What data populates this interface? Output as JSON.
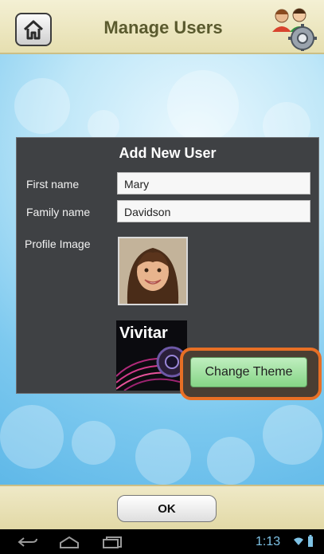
{
  "header": {
    "title": "Manage Users",
    "home_icon": "home-icon",
    "users_icon": "users-settings-icon"
  },
  "dialog": {
    "title": "Add New User",
    "first_name_label": "First name",
    "first_name_value": "Mary",
    "family_name_label": "Family name",
    "family_name_value": "Davidson",
    "profile_image_label": "Profile Image",
    "theme_thumbnail_text": "Vivitar",
    "change_theme_label": "Change Theme"
  },
  "footer": {
    "ok_label": "OK"
  },
  "system_bar": {
    "time": "1:13",
    "back_icon": "back-icon",
    "home_icon": "nav-home-icon",
    "recent_icon": "recent-apps-icon"
  },
  "colors": {
    "highlight": "#e86f25",
    "dialog_bg": "#3f4144",
    "button_green": "#86d586",
    "header_bg": "#f4f0d4"
  }
}
